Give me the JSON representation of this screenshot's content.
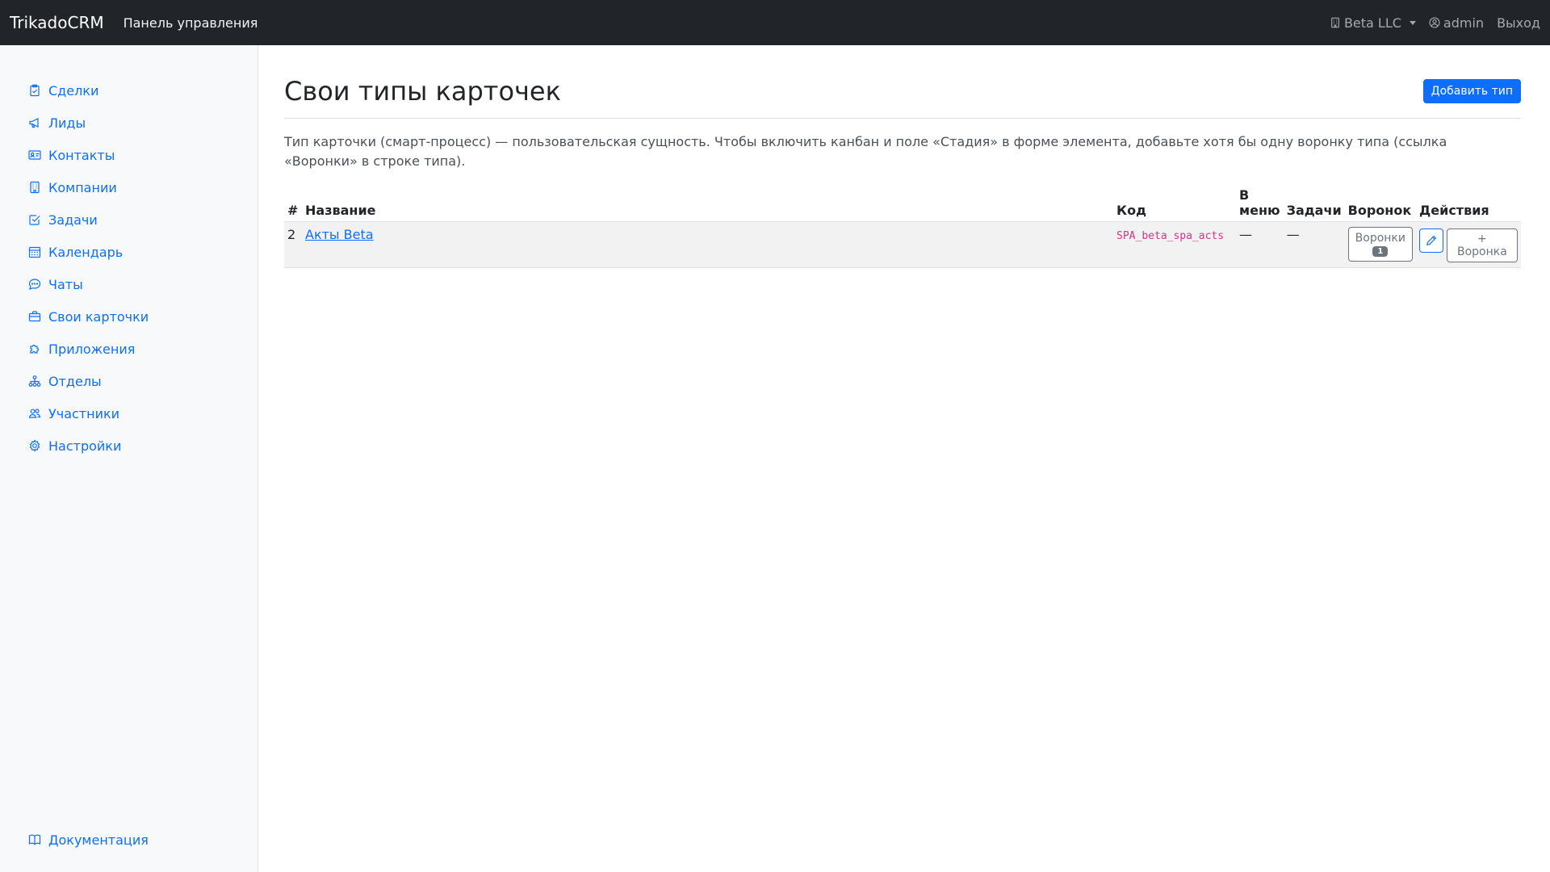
{
  "navbar": {
    "brand": "TrikadoCRM",
    "panel_link": "Панель управления",
    "company": "Beta LLC",
    "user": "admin",
    "logout": "Выход"
  },
  "sidebar": {
    "items": [
      {
        "label": "Сделки",
        "icon": "clipboard-icon"
      },
      {
        "label": "Лиды",
        "icon": "megaphone-icon"
      },
      {
        "label": "Контакты",
        "icon": "contact-card-icon"
      },
      {
        "label": "Компании",
        "icon": "building-icon"
      },
      {
        "label": "Задачи",
        "icon": "check-square-icon"
      },
      {
        "label": "Календарь",
        "icon": "calendar-icon"
      },
      {
        "label": "Чаты",
        "icon": "chat-icon"
      },
      {
        "label": "Свои карточки",
        "icon": "briefcase-icon"
      },
      {
        "label": "Приложения",
        "icon": "puzzle-icon"
      },
      {
        "label": "Отделы",
        "icon": "diagram-icon"
      },
      {
        "label": "Участники",
        "icon": "people-icon"
      },
      {
        "label": "Настройки",
        "icon": "gear-icon"
      }
    ],
    "docs": "Документация"
  },
  "page": {
    "title": "Свои типы карточек",
    "add_button": "Добавить тип",
    "description": "Тип карточки (смарт-процесс) — пользовательская сущность. Чтобы включить канбан и поле «Стадия» в форме элемента, добавьте хотя бы одну воронку типа (ссылка «Воронки» в строке типа)."
  },
  "table": {
    "headers": {
      "num": "#",
      "name": "Название",
      "code": "Код",
      "menu": "В меню",
      "tasks": "Задачи",
      "funnels": "Воронок",
      "actions": "Действия"
    },
    "rows": [
      {
        "num": "2",
        "name": "Акты Beta",
        "code": "SPA_beta_spa_acts",
        "menu": "—",
        "tasks": "—",
        "funnels_label": "Воронки",
        "funnels_count": "1",
        "add_funnel": "+ Воронка"
      }
    ]
  },
  "colors": {
    "navbar_bg": "#212529",
    "link": "#0d6efd",
    "sidebar_bg": "#f8f9fa",
    "code": "#d63384"
  }
}
